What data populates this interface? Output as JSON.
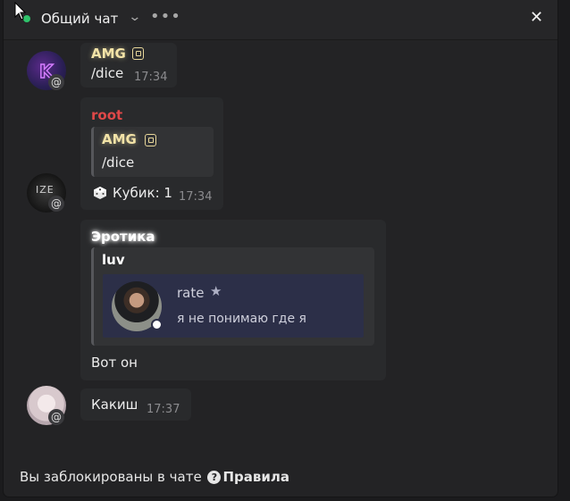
{
  "header": {
    "title": "Общий чат",
    "status_color": "#2fc36b",
    "more_icon": "more-horizontal-icon",
    "close_icon": "close-icon"
  },
  "messages": [
    {
      "author": "AMG",
      "author_color": "#f3e3a7",
      "badge_icon": "shield-icon",
      "text": "/dice",
      "time": "17:34",
      "mention_badge": "@"
    },
    {
      "author": "root",
      "author_color": "#e04848",
      "quote": {
        "author": "AMG",
        "text": "/dice"
      },
      "dice_icon": "dice-icon",
      "text": "Кубик: 1",
      "time": "17:34",
      "mention_badge": "@",
      "avatar_text": "IZE"
    },
    {
      "author": "Эротика",
      "author_color": "#ffffff",
      "quote": {
        "author": "luv",
        "embed": {
          "name": "rate",
          "name_icon": "star-icon",
          "text": "я не понимаю где я"
        }
      },
      "text": "Вот он"
    },
    {
      "author": "",
      "text": "Какиш",
      "time": "17:37",
      "mention_badge": "@"
    }
  ],
  "footer": {
    "blocked_text": "Вы заблокированы в чате",
    "help_icon": "?",
    "rules_link": "Правила"
  }
}
